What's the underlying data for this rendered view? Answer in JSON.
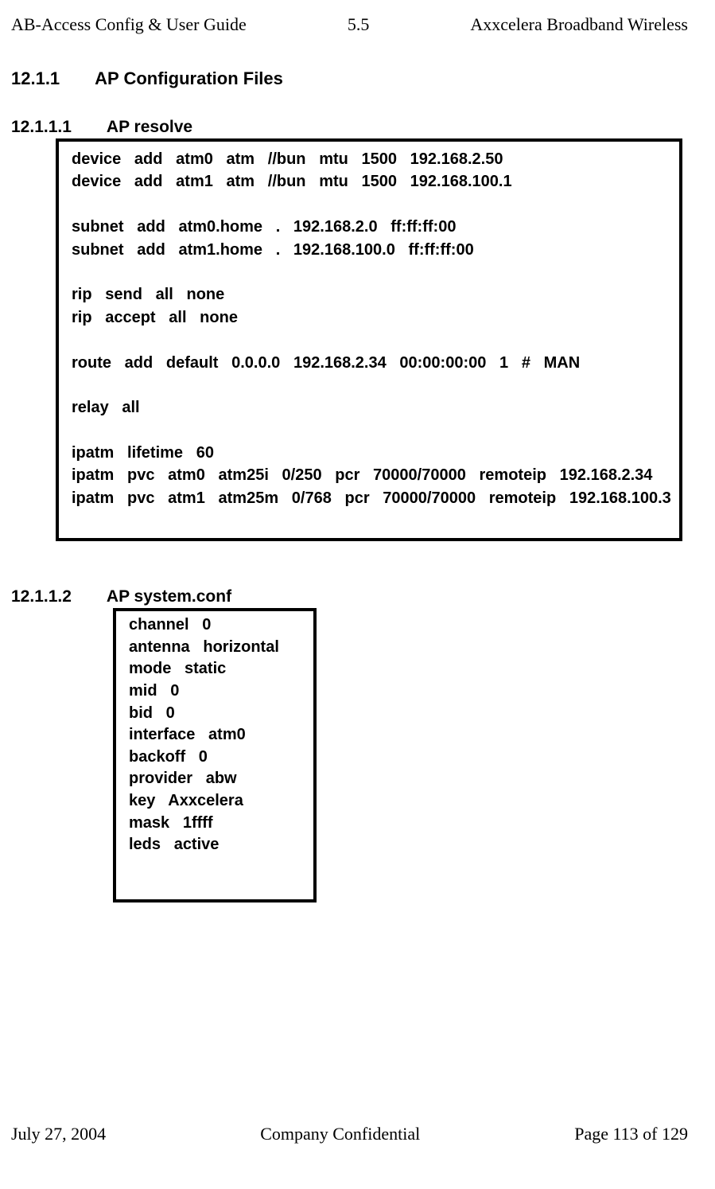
{
  "header": {
    "left": "AB-Access Config & User Guide",
    "center": "5.5",
    "right": "Axxcelera Broadband Wireless"
  },
  "section": {
    "number": "12.1.1",
    "title": "AP Configuration Files"
  },
  "subsection1": {
    "number": "12.1.1.1",
    "title": "AP resolve",
    "config": "device   add   atm0   atm   //bun   mtu   1500   192.168.2.50\ndevice   add   atm1   atm   //bun   mtu   1500   192.168.100.1\n\nsubnet   add   atm0.home   .   192.168.2.0   ff:ff:ff:00\nsubnet   add   atm1.home   .   192.168.100.0   ff:ff:ff:00\n\nrip   send   all   none\nrip   accept   all   none\n\nroute   add   default   0.0.0.0   192.168.2.34   00:00:00:00   1   #   MAN\n\nrelay   all\n\nipatm   lifetime   60\nipatm   pvc   atm0   atm25i   0/250   pcr   70000/70000   remoteip   192.168.2.34\nipatm   pvc   atm1   atm25m   0/768   pcr   70000/70000   remoteip   192.168.100.3"
  },
  "subsection2": {
    "number": "12.1.1.2",
    "title": "AP system.conf",
    "config": "channel   0\nantenna   horizontal\nmode   static\nmid   0\nbid   0\ninterface   atm0\nbackoff   0\nprovider   abw\nkey   Axxcelera\nmask   1ffff\nleds   active"
  },
  "footer": {
    "left": "July 27, 2004",
    "center": "Company Confidential",
    "right": "Page 113 of 129"
  }
}
